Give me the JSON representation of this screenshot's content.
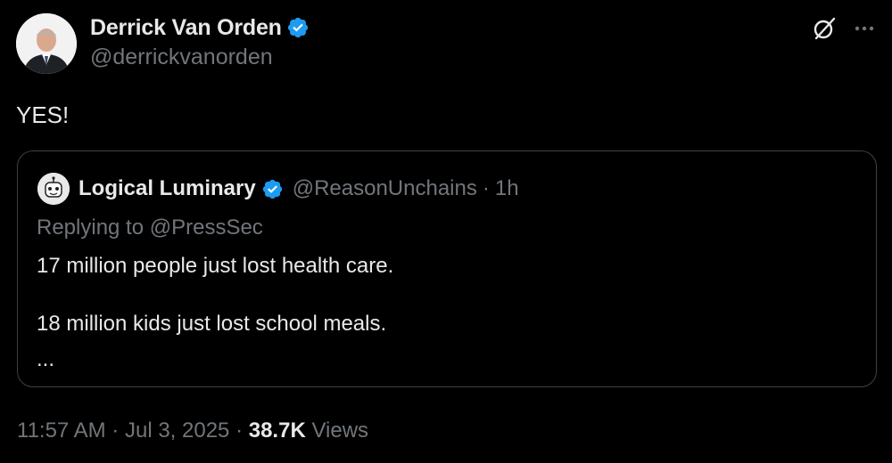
{
  "author": {
    "display_name": "Derrick Van Orden",
    "handle": "@derrickvanorden",
    "verified": true,
    "avatar": "person-portrait"
  },
  "tweet": {
    "text": "YES!"
  },
  "quoted_tweet": {
    "display_name": "Logical Luminary",
    "handle": "@ReasonUnchains",
    "separator": "·",
    "time": "1h",
    "verified": true,
    "replying_to": "Replying to @PressSec",
    "lines": [
      "17 million people just lost health care.",
      "18 million kids just lost school meals.",
      "..."
    ]
  },
  "footer": {
    "time": "11:57 AM",
    "sep1": "·",
    "date": "Jul 3, 2025",
    "sep2": "·",
    "views_count": "38.7K",
    "views_label": "Views"
  },
  "icons": {
    "verified_badge": "verified-badge-icon",
    "grok": "grok-icon",
    "more": "more-icon"
  },
  "colors": {
    "background": "#000000",
    "text_primary": "#e7e9ea",
    "text_secondary": "#71767b",
    "verified_blue": "#1d9bf0",
    "border": "#3e4144"
  }
}
